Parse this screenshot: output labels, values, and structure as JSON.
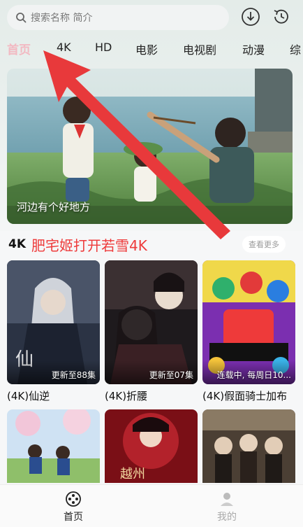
{
  "search": {
    "placeholder": "搜索名称 简介"
  },
  "top_icons": [
    "download-icon",
    "history-icon"
  ],
  "tabs": [
    {
      "label": "首页",
      "active": true
    },
    {
      "label": "4K"
    },
    {
      "label": "HD"
    },
    {
      "label": "电影"
    },
    {
      "label": "电视剧"
    },
    {
      "label": "动漫"
    },
    {
      "label": "综"
    }
  ],
  "banner": {
    "caption": "河边有个好地方"
  },
  "section": {
    "tag": "4K",
    "title": "肥宅姬打开若雪4K",
    "more_label": "查看更多"
  },
  "cards": [
    {
      "title": "(4K)仙逆",
      "badge": "更新至88集"
    },
    {
      "title": "(4K)折腰",
      "badge": "更新至07集"
    },
    {
      "title": "(4K)假面骑士加布",
      "badge": "连载中, 每周日10..."
    }
  ],
  "bottom_nav": [
    {
      "label": "首页",
      "active": true
    },
    {
      "label": "我的"
    }
  ],
  "colors": {
    "accent_red": "#ee3a3a",
    "active_tab": "#f2b9c2",
    "arrow": "#e8393b"
  }
}
